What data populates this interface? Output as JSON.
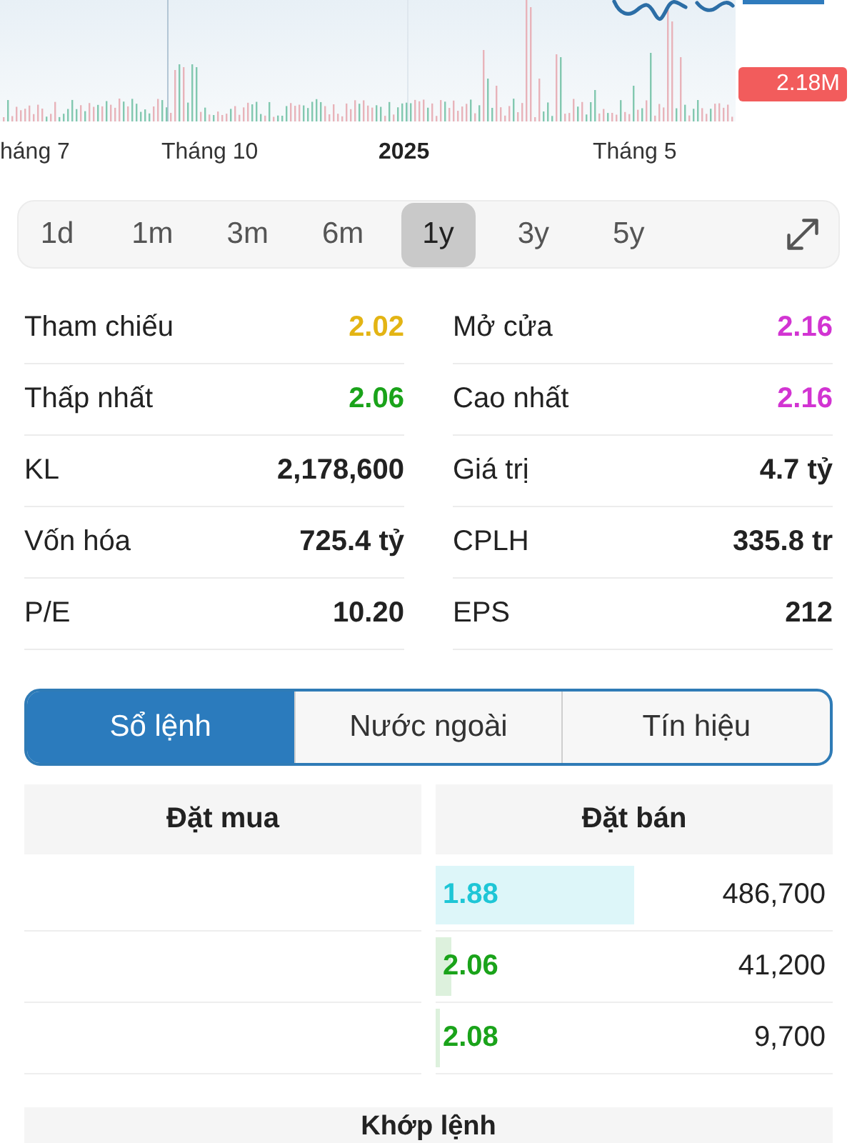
{
  "chart": {
    "x_labels": [
      {
        "text": "háng 7",
        "bold": false
      },
      {
        "text": "Tháng 10",
        "bold": false
      },
      {
        "text": "2025",
        "bold": true
      },
      {
        "text": "Tháng 5",
        "bold": false
      }
    ],
    "volume_badge": "2.18M"
  },
  "ranges": [
    {
      "label": "1d",
      "selected": false
    },
    {
      "label": "1m",
      "selected": false
    },
    {
      "label": "3m",
      "selected": false
    },
    {
      "label": "6m",
      "selected": false
    },
    {
      "label": "1y",
      "selected": true
    },
    {
      "label": "3y",
      "selected": false
    },
    {
      "label": "5y",
      "selected": false
    }
  ],
  "stats": [
    {
      "label": "Tham chiếu",
      "value": "2.02",
      "color": "#e3b414"
    },
    {
      "label": "Mở cửa",
      "value": "2.16",
      "color": "#d234d2"
    },
    {
      "label": "Thấp nhất",
      "value": "2.06",
      "color": "#1aa31a"
    },
    {
      "label": "Cao nhất",
      "value": "2.16",
      "color": "#d234d2"
    },
    {
      "label": "KL",
      "value": "2,178,600"
    },
    {
      "label": "Giá trị",
      "value": "4.7 tỷ"
    },
    {
      "label": "Vốn hóa",
      "value": "725.4 tỷ"
    },
    {
      "label": "CPLH",
      "value": "335.8 tr"
    },
    {
      "label": "P/E",
      "value": "10.20"
    },
    {
      "label": "EPS",
      "value": "212"
    }
  ],
  "tabs": [
    {
      "label": "Sổ lệnh",
      "selected": true
    },
    {
      "label": "Nước ngoài",
      "selected": false
    },
    {
      "label": "Tín hiệu",
      "selected": false
    }
  ],
  "order_book": {
    "columns": [
      "Đặt mua",
      "Đặt bán"
    ],
    "asks": [
      {
        "price": "1.88",
        "volume": "486,700",
        "color": "#1ec6d6",
        "level": 0.5
      },
      {
        "price": "2.06",
        "volume": "41,200",
        "color": "#1aa31a",
        "level": 0.04
      },
      {
        "price": "2.08",
        "volume": "9,700",
        "color": "#1aa31a",
        "level": 0.01
      }
    ]
  },
  "match": {
    "title": "Khớp lệnh"
  }
}
